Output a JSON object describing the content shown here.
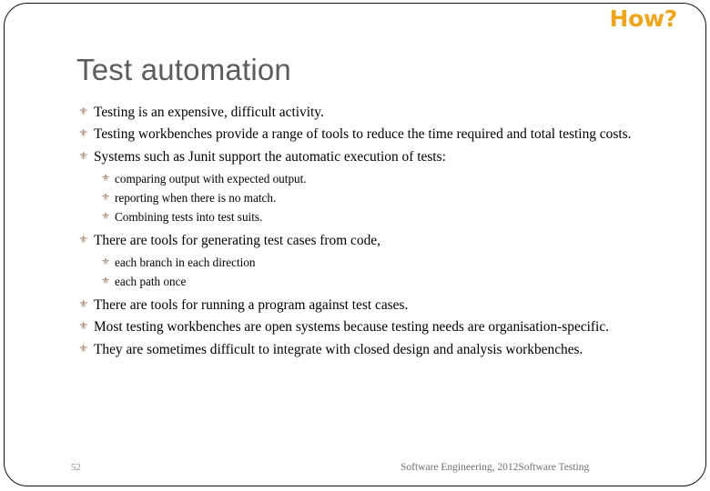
{
  "slide": {
    "corner_label": "How?",
    "title": "Test automation",
    "bullet_glyph": "⚜",
    "page_number": "52",
    "footer": "Software Engineering,  2012Software Testing",
    "colors": {
      "corner_label": "#eda51c",
      "title": "#5c5c5c",
      "bullet_glyph": "#9a7a62",
      "body_text": "#000000",
      "footer": "#6f6f6f",
      "frame": "#111111",
      "background": "#ffffff"
    },
    "content": [
      {
        "level": 1,
        "text": "Testing is an expensive, difficult activity."
      },
      {
        "level": 1,
        "text": "Testing workbenches provide a range of tools to reduce the time required and total testing costs."
      },
      {
        "level": 1,
        "text": "Systems such as Junit support the automatic execution of tests:"
      },
      {
        "level": 2,
        "text": "comparing output with expected output."
      },
      {
        "level": 2,
        "text": "reporting when there is no match."
      },
      {
        "level": 2,
        "text": "Combining tests into test suits."
      },
      {
        "level": 1,
        "text": "There are tools for generating test cases from code,"
      },
      {
        "level": 2,
        "text": "each branch in each direction"
      },
      {
        "level": 2,
        "text": "each path once"
      },
      {
        "level": 1,
        "text": "There are tools for running a program against test cases."
      },
      {
        "level": 1,
        "text": "Most testing workbenches are open systems because testing needs are organisation-specific."
      },
      {
        "level": 1,
        "text": "They are sometimes difficult to integrate with closed design and analysis workbenches."
      }
    ]
  }
}
